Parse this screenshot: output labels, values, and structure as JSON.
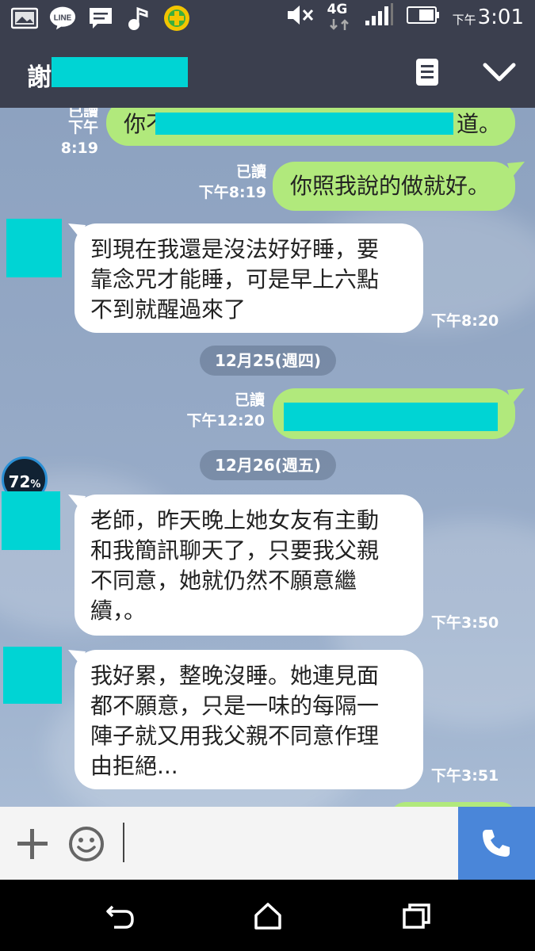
{
  "status_bar": {
    "left_icons": [
      "gallery-icon",
      "line-app-icon",
      "message-icon",
      "music-icon",
      "plus-app-icon"
    ],
    "line_label": "LINE",
    "right_icons": [
      "mute-icon",
      "network-4g-icon",
      "signal-icon",
      "battery-icon"
    ],
    "network_label": "4G",
    "time_prefix": "下午",
    "time": "3:01"
  },
  "header": {
    "contact_name": "謝",
    "menu_icon": "note-icon",
    "collapse_icon": "chevron-down-icon"
  },
  "messages": [
    {
      "side": "right",
      "read": "已讀",
      "time": "下午8:19",
      "text_start": "你不",
      "text_end": "道。",
      "redacted": true
    },
    {
      "side": "right",
      "read": "已讀",
      "time": "下午8:19",
      "text": "你照我說的做就好。"
    },
    {
      "side": "left",
      "time": "下午8:20",
      "lines": [
        "到現在我還是沒法好好睡，要",
        "靠念咒才能睡，可是早上六點",
        "不到就醒過來了"
      ]
    },
    {
      "side": "right",
      "read": "已讀",
      "time": "下午12:20",
      "redacted": true
    },
    {
      "side": "left",
      "time": "下午3:50",
      "lines": [
        "老師，昨天晚上她女友有主動",
        "和我簡訊聊天了，只要我父親",
        "不同意，她就仍然不願意繼",
        "續，。"
      ]
    },
    {
      "side": "left",
      "time": "下午3:51",
      "lines": [
        "我好累，整晚沒睡。她連見面",
        "都不願意，只是一味的每隔一",
        "陣子就又用我父親不同意作理",
        "由拒絕..."
      ]
    }
  ],
  "dates": [
    "12月25(週四)",
    "12月26(週五)"
  ],
  "overlay_badge": "72",
  "overlay_badge_unit": "%",
  "input_bar": {
    "plus_icon": "plus-icon",
    "emoji_icon": "smile-icon",
    "call_icon": "phone-icon"
  },
  "nav_bar": {
    "icons": [
      "back-icon",
      "home-icon",
      "recents-icon"
    ]
  },
  "colors": {
    "header": "#3b3f4e",
    "green_bubble": "#b1e97c",
    "redaction": "#00d4d4",
    "call_button": "#4a86d9"
  }
}
